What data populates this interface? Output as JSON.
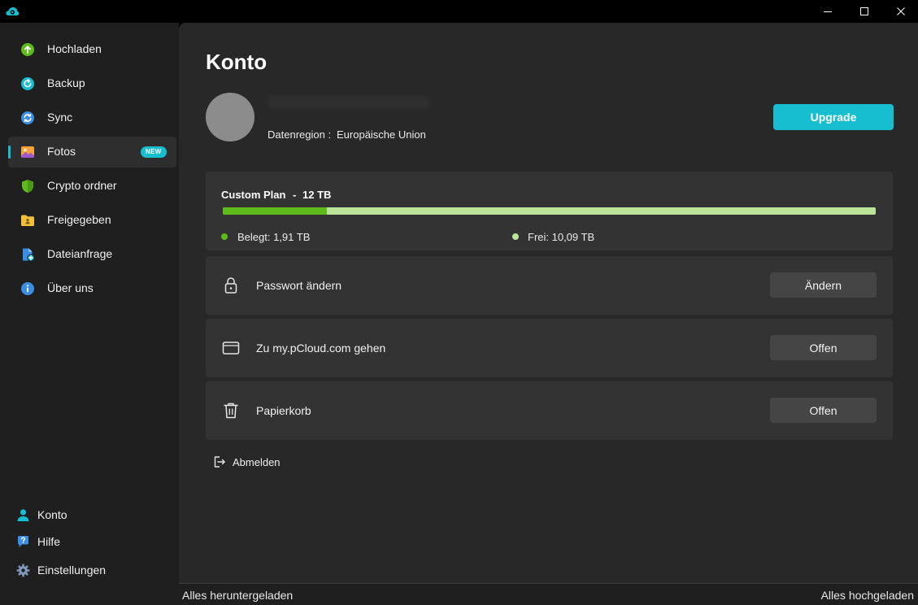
{
  "window": {
    "app_icon": "pcloud-logo-icon",
    "controls": [
      "minimize-icon",
      "maximize-icon",
      "close-icon"
    ]
  },
  "sidebar": {
    "items": [
      {
        "label": "Hochladen",
        "icon": "upload-icon",
        "active": false
      },
      {
        "label": "Backup",
        "icon": "backup-icon",
        "active": false
      },
      {
        "label": "Sync",
        "icon": "sync-icon",
        "active": false
      },
      {
        "label": "Fotos",
        "icon": "photos-icon",
        "active": true,
        "badge": "NEW"
      },
      {
        "label": "Crypto ordner",
        "icon": "shield-icon",
        "active": false
      },
      {
        "label": "Freigegeben",
        "icon": "shared-folder-icon",
        "active": false
      },
      {
        "label": "Dateianfrage",
        "icon": "file-request-icon",
        "active": false
      },
      {
        "label": "Über uns",
        "icon": "info-icon",
        "active": false
      }
    ],
    "bottom": [
      {
        "label": "Konto",
        "icon": "user-icon"
      },
      {
        "label": "Hilfe",
        "icon": "help-icon"
      },
      {
        "label": "Einstellungen",
        "icon": "gear-icon"
      }
    ]
  },
  "account": {
    "title": "Konto",
    "region_label": "Datenregion :",
    "region_value": "Europäische Union",
    "upgrade_label": "Upgrade",
    "plan": {
      "name": "Custom Plan",
      "separator": "-",
      "size": "12 TB",
      "used_label": "Belegt: 1,91 TB",
      "free_label": "Frei: 10,09 TB",
      "used_fraction": 0.159,
      "used_color": "#5fba1c",
      "free_color": "#bde59a"
    },
    "actions": [
      {
        "label": "Passwort ändern",
        "button": "Ändern",
        "icon": "lock-icon"
      },
      {
        "label": "Zu my.pCloud.com gehen",
        "button": "Offen",
        "icon": "browser-window-icon"
      },
      {
        "label": "Papierkorb",
        "button": "Offen",
        "icon": "trash-icon"
      }
    ],
    "logout_label": "Abmelden"
  },
  "status": {
    "left": "Alles heruntergeladen",
    "right": "Alles hochgeladen"
  },
  "colors": {
    "accent": "#17bed0",
    "background": "#282828",
    "sidebar": "#1f1f1f",
    "card": "#333333"
  }
}
